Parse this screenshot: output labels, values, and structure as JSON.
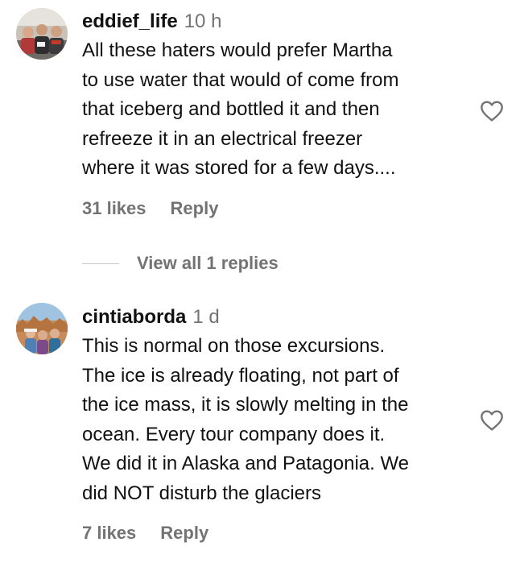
{
  "comments": [
    {
      "username": "eddief_life",
      "time": "10 h",
      "lines": [
        "All these haters would prefer Martha",
        "to use water that would of come from",
        "that iceberg and bottled it and then",
        "refreeze it in an electrical freezer",
        "where it was stored for a few days...."
      ],
      "likes": "31 likes",
      "reply": "Reply",
      "view_replies": "View all 1 replies"
    },
    {
      "username": "cintiaborda",
      "time": "1 d",
      "lines": [
        "This is normal on those excursions.",
        "The ice is already floating, not part of",
        "the ice mass, it is slowly melting in the",
        "ocean. Every tour company does it.",
        "We did it in Alaska and Patagonia. We",
        "did NOT disturb the glaciers"
      ],
      "likes": "7 likes",
      "reply": "Reply"
    }
  ],
  "colors": {
    "text": "#111111",
    "secondary": "#737373",
    "divider": "#c7c7c7"
  },
  "icons": {
    "like": "heart-outline-icon"
  }
}
